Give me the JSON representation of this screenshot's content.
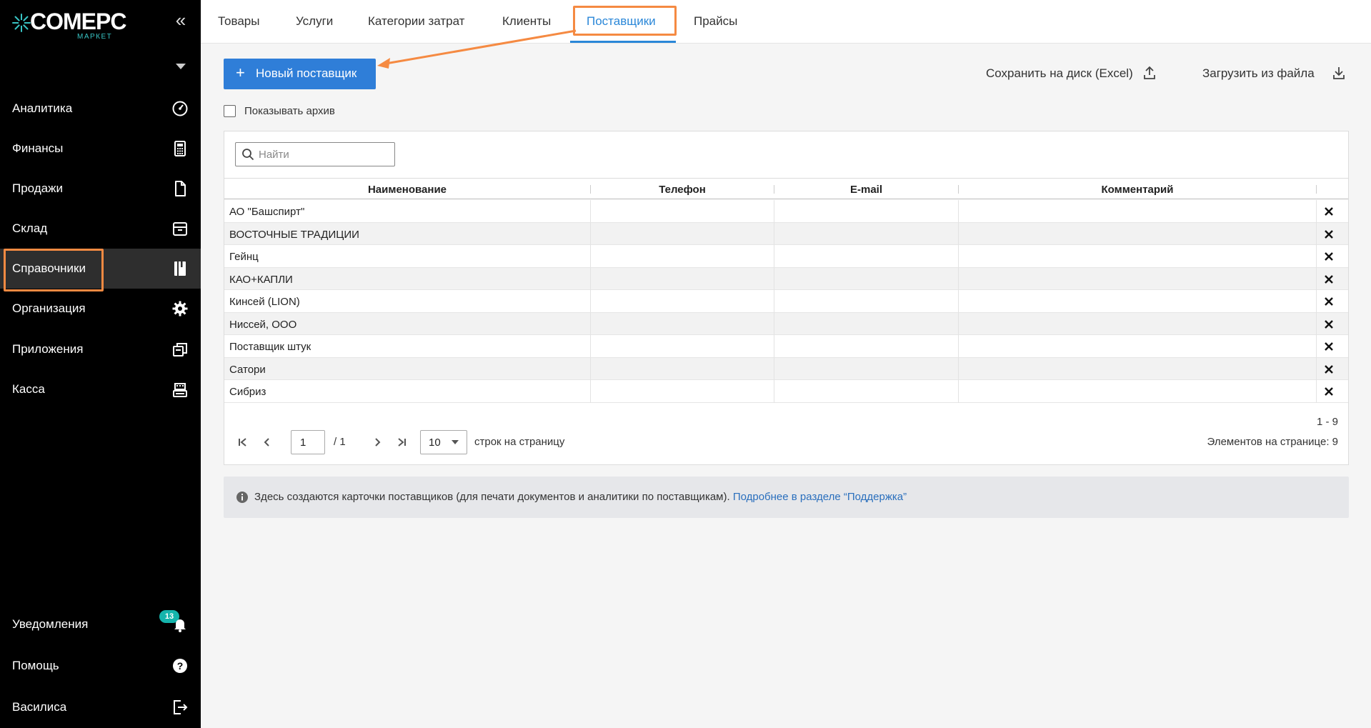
{
  "brand": {
    "name": "COMEPC",
    "sub": "МАРКЕТ"
  },
  "sidebar": {
    "items": [
      {
        "label": "Аналитика",
        "icon": "gauge-icon"
      },
      {
        "label": "Финансы",
        "icon": "calculator-icon"
      },
      {
        "label": "Продажи",
        "icon": "document-icon"
      },
      {
        "label": "Склад",
        "icon": "box-icon"
      },
      {
        "label": "Справочники",
        "icon": "book-icon",
        "active": true
      },
      {
        "label": "Организация",
        "icon": "gear-icon"
      },
      {
        "label": "Приложения",
        "icon": "windows-icon"
      },
      {
        "label": "Касса",
        "icon": "register-icon"
      }
    ],
    "bottom": [
      {
        "label": "Уведомления",
        "icon": "bell-icon",
        "badge": "13"
      },
      {
        "label": "Помощь",
        "icon": "help-icon"
      },
      {
        "label": "Василиса",
        "icon": "logout-icon"
      }
    ]
  },
  "tabs": [
    "Товары",
    "Услуги",
    "Категории затрат",
    "Клиенты",
    "Поставщики",
    "Прайсы"
  ],
  "active_tab": "Поставщики",
  "toolbar": {
    "new_button": "Новый поставщик",
    "save_excel": "Сохранить на диск (Excel)",
    "load_file": "Загрузить из файла",
    "show_archive": "Показывать архив"
  },
  "search": {
    "placeholder": "Найти",
    "value": ""
  },
  "table": {
    "columns": [
      "Наименование",
      "Телефон",
      "E-mail",
      "Комментарий"
    ],
    "rows": [
      {
        "name": "АО \"Башспирт\"",
        "phone": "",
        "email": "",
        "comment": ""
      },
      {
        "name": "ВОСТОЧНЫЕ ТРАДИЦИИ",
        "phone": "",
        "email": "",
        "comment": ""
      },
      {
        "name": "Гейнц",
        "phone": "",
        "email": "",
        "comment": ""
      },
      {
        "name": "КАО+КАПЛИ",
        "phone": "",
        "email": "",
        "comment": ""
      },
      {
        "name": "Кинсей (LION)",
        "phone": "",
        "email": "",
        "comment": ""
      },
      {
        "name": "Ниссей, ООО",
        "phone": "",
        "email": "",
        "comment": ""
      },
      {
        "name": "Поставщик штук",
        "phone": "",
        "email": "",
        "comment": ""
      },
      {
        "name": "Сатори",
        "phone": "",
        "email": "",
        "comment": ""
      },
      {
        "name": "Сибриз",
        "phone": "",
        "email": "",
        "comment": ""
      }
    ]
  },
  "pagination": {
    "page": "1",
    "total_pages_label": "/ 1",
    "per_page": "10",
    "per_page_label": "строк на страницу",
    "range": "1 - 9",
    "items_label": "Элементов на странице: 9"
  },
  "info": {
    "text": "Здесь создаются карточки поставщиков (для печати документов и аналитики по поставщикам).",
    "link": "Подробнее в разделе “Поддержка”"
  },
  "colors": {
    "accent": "#2f7ed8",
    "highlight": "#f58a42",
    "sidebar_bg": "#000000",
    "badge": "#15b4ac"
  }
}
